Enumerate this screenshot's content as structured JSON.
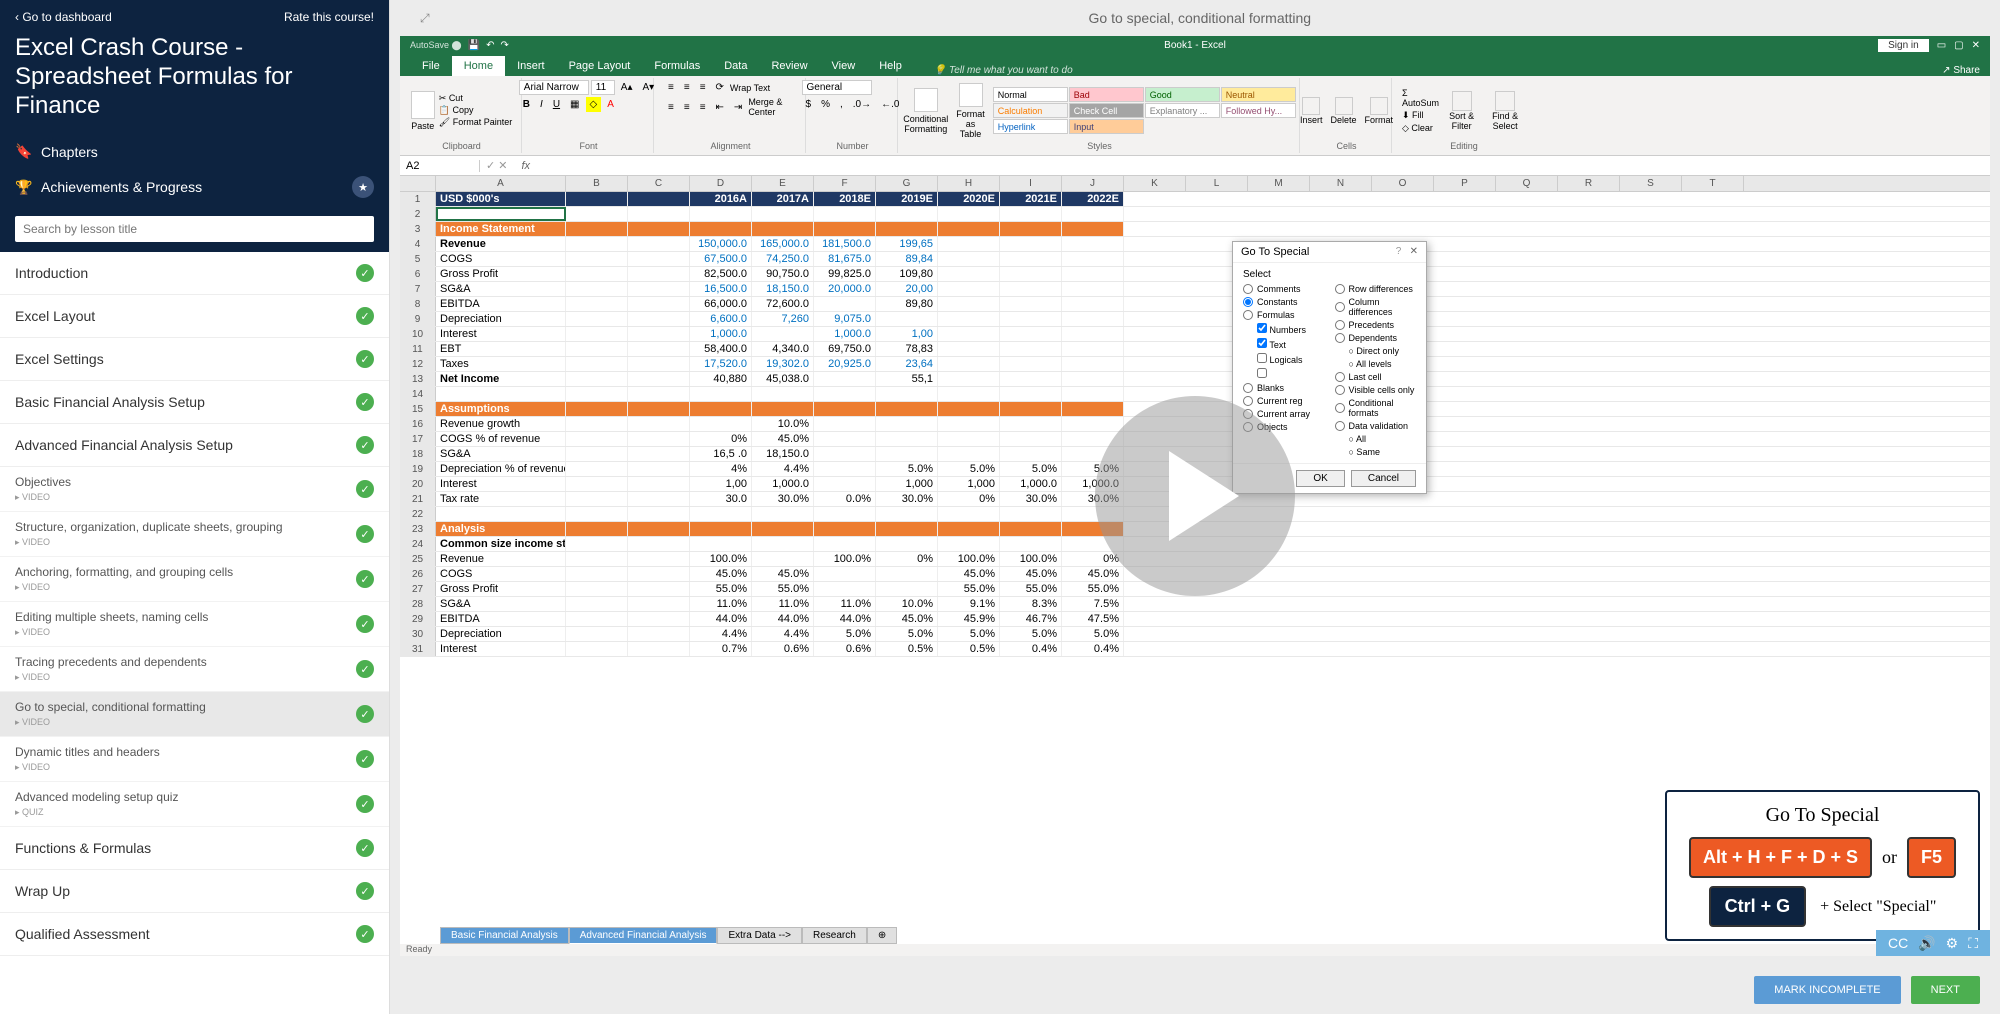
{
  "sidebar": {
    "back_link": "Go to dashboard",
    "rate_link": "Rate this course!",
    "title": "Excel Crash Course - Spreadsheet Formulas for Finance",
    "chapters_label": "Chapters",
    "achievements_label": "Achievements & Progress",
    "search_placeholder": "Search by lesson title",
    "chapters": [
      {
        "title": "Introduction",
        "complete": true
      },
      {
        "title": "Excel Layout",
        "complete": true
      },
      {
        "title": "Excel Settings",
        "complete": true
      },
      {
        "title": "Basic Financial Analysis Setup",
        "complete": true
      },
      {
        "title": "Advanced Financial Analysis Setup",
        "complete": true,
        "expanded": true,
        "subs": [
          {
            "title": "Objectives",
            "type": "VIDEO",
            "complete": true
          },
          {
            "title": "Structure, organization, duplicate sheets, grouping",
            "type": "VIDEO",
            "complete": true
          },
          {
            "title": "Anchoring, formatting, and grouping cells",
            "type": "VIDEO",
            "complete": true
          },
          {
            "title": "Editing multiple sheets, naming cells",
            "type": "VIDEO",
            "complete": true
          },
          {
            "title": "Tracing precedents and dependents",
            "type": "VIDEO",
            "complete": true
          },
          {
            "title": "Go to special, conditional formatting",
            "type": "VIDEO",
            "complete": true,
            "active": true
          },
          {
            "title": "Dynamic titles and headers",
            "type": "VIDEO",
            "complete": true
          },
          {
            "title": "Advanced modeling setup quiz",
            "type": "QUIZ",
            "complete": true
          }
        ]
      },
      {
        "title": "Functions & Formulas",
        "complete": true
      },
      {
        "title": "Wrap Up",
        "complete": true
      },
      {
        "title": "Qualified Assessment",
        "complete": true
      }
    ]
  },
  "main": {
    "lesson_title": "Go to special, conditional formatting",
    "mark_incomplete": "MARK INCOMPLETE",
    "next": "NEXT"
  },
  "excel": {
    "title": "Book1 - Excel",
    "signin": "Sign in",
    "tabs": [
      "File",
      "Home",
      "Insert",
      "Page Layout",
      "Formulas",
      "Data",
      "Review",
      "View",
      "Help"
    ],
    "active_tab": "Home",
    "tellme": "Tell me what you want to do",
    "share": "Share",
    "ribbon": {
      "clipboard": {
        "paste": "Paste",
        "cut": "Cut",
        "copy": "Copy",
        "painter": "Format Painter",
        "label": "Clipboard"
      },
      "font": {
        "name": "Arial Narrow",
        "size": "11",
        "label": "Font"
      },
      "alignment": {
        "wrap": "Wrap Text",
        "merge": "Merge & Center",
        "label": "Alignment"
      },
      "number": {
        "format": "General",
        "label": "Number"
      },
      "styles": {
        "cond": "Conditional Formatting",
        "table": "Format as Table",
        "cells": [
          {
            "t": "Normal",
            "bg": "#fff",
            "c": "#000"
          },
          {
            "t": "Bad",
            "bg": "#ffc7ce",
            "c": "#9c0006"
          },
          {
            "t": "Good",
            "bg": "#c6efce",
            "c": "#006100"
          },
          {
            "t": "Neutral",
            "bg": "#ffeb9c",
            "c": "#9c5700"
          },
          {
            "t": "Calculation",
            "bg": "#f2f2f2",
            "c": "#fa7d00"
          },
          {
            "t": "Check Cell",
            "bg": "#a5a5a5",
            "c": "#fff"
          },
          {
            "t": "Explanatory ...",
            "bg": "#fff",
            "c": "#7f7f7f"
          },
          {
            "t": "Followed Hy...",
            "bg": "#fff",
            "c": "#954f72"
          },
          {
            "t": "Hyperlink",
            "bg": "#fff",
            "c": "#0563c1"
          },
          {
            "t": "Input",
            "bg": "#ffcc99",
            "c": "#3f3f76"
          }
        ],
        "label": "Styles"
      },
      "cells": {
        "insert": "Insert",
        "delete": "Delete",
        "format": "Format",
        "label": "Cells"
      },
      "editing": {
        "autosum": "AutoSum",
        "fill": "Fill",
        "clear": "Clear",
        "sort": "Sort & Filter",
        "find": "Find & Select",
        "label": "Editing"
      }
    },
    "namebox": "A2",
    "columns": [
      "A",
      "B",
      "C",
      "D",
      "E",
      "F",
      "G",
      "H",
      "I",
      "J",
      "K",
      "L",
      "M",
      "N",
      "O",
      "P",
      "Q",
      "R",
      "S",
      "T"
    ],
    "sheet_tabs": [
      "Basic Financial Analysis",
      "Advanced Financial Analysis",
      "Extra Data -->",
      "Research"
    ],
    "status": "Ready",
    "grid": [
      {
        "r": 1,
        "type": "header",
        "a": "USD $000's",
        "vals": [
          "",
          "",
          "2016A",
          "2017A",
          "2018E",
          "2019E",
          "2020E",
          "2021E",
          "2022E"
        ]
      },
      {
        "r": 2,
        "type": "sel",
        "a": "",
        "vals": [
          "",
          "",
          "",
          "",
          "",
          "",
          "",
          "",
          ""
        ]
      },
      {
        "r": 3,
        "type": "section",
        "a": "Income Statement",
        "vals": [
          "",
          "",
          "",
          "",
          "",
          "",
          "",
          "",
          ""
        ]
      },
      {
        "r": 4,
        "type": "bold",
        "a": "Revenue",
        "cls": "blue-text",
        "vals": [
          "",
          "",
          "150,000.0",
          "165,000.0",
          "181,500.0",
          "199,65",
          "",
          "",
          ""
        ]
      },
      {
        "r": 5,
        "a": "COGS",
        "cls": "blue-text",
        "vals": [
          "",
          "",
          "67,500.0",
          "74,250.0",
          "81,675.0",
          "89,84",
          "",
          "",
          ""
        ]
      },
      {
        "r": 6,
        "a": "Gross Profit",
        "vals": [
          "",
          "",
          "82,500.0",
          "90,750.0",
          "99,825.0",
          "109,80",
          "",
          "",
          ""
        ]
      },
      {
        "r": 7,
        "a": "SG&A",
        "cls": "blue-text",
        "vals": [
          "",
          "",
          "16,500.0",
          "18,150.0",
          "20,000.0",
          "20,00",
          "",
          "",
          ""
        ]
      },
      {
        "r": 8,
        "a": "EBITDA",
        "vals": [
          "",
          "",
          "66,000.0",
          "72,600.0",
          "",
          "89,80",
          "",
          "",
          ""
        ]
      },
      {
        "r": 9,
        "a": "Depreciation",
        "cls": "blue-text",
        "vals": [
          "",
          "",
          "6,600.0",
          "7,260",
          "9,075.0",
          "",
          "",
          "",
          ""
        ]
      },
      {
        "r": 10,
        "a": "Interest",
        "cls": "blue-text",
        "vals": [
          "",
          "",
          "1,000.0",
          "",
          "1,000.0",
          "1,00",
          "",
          "",
          ""
        ]
      },
      {
        "r": 11,
        "a": "EBT",
        "vals": [
          "",
          "",
          "58,400.0",
          "4,340.0",
          "69,750.0",
          "78,83",
          "",
          "",
          ""
        ]
      },
      {
        "r": 12,
        "a": "Taxes",
        "cls": "blue-text",
        "vals": [
          "",
          "",
          "17,520.0",
          "19,302.0",
          "20,925.0",
          "23,64",
          "",
          "",
          ""
        ]
      },
      {
        "r": 13,
        "type": "bold",
        "a": "Net Income",
        "vals": [
          "",
          "",
          "40,880",
          "45,038.0",
          "",
          "55,1",
          "",
          "",
          ""
        ]
      },
      {
        "r": 14,
        "a": "",
        "vals": [
          "",
          "",
          "",
          "",
          "",
          "",
          "",
          "",
          ""
        ]
      },
      {
        "r": 15,
        "type": "section",
        "a": "Assumptions",
        "vals": [
          "",
          "",
          "",
          "",
          "",
          "",
          "",
          "",
          ""
        ]
      },
      {
        "r": 16,
        "a": "Revenue growth",
        "vals": [
          "",
          "",
          "",
          "10.0%",
          "",
          "",
          "",
          "",
          ""
        ]
      },
      {
        "r": 17,
        "a": "COGS % of revenue",
        "vals": [
          "",
          "",
          "0%",
          "45.0%",
          "",
          "",
          "",
          "",
          ""
        ]
      },
      {
        "r": 18,
        "a": "SG&A",
        "vals": [
          "",
          "",
          "16,5   .0",
          "18,150.0",
          "",
          "",
          "",
          "",
          ""
        ]
      },
      {
        "r": 19,
        "a": "Depreciation % of revenue",
        "vals": [
          "",
          "",
          "4%",
          "4.4%",
          "",
          "5.0%",
          "5.0%",
          "5.0%",
          "5.0%"
        ]
      },
      {
        "r": 20,
        "a": "Interest",
        "vals": [
          "",
          "",
          "1,00",
          "1,000.0",
          "",
          "1,000",
          "1,000",
          "1,000.0",
          "1,000.0"
        ]
      },
      {
        "r": 21,
        "a": "Tax rate",
        "vals": [
          "",
          "",
          "30.0",
          "30.0%",
          "0.0%",
          "30.0%",
          "0%",
          "30.0%",
          "30.0%"
        ]
      },
      {
        "r": 22,
        "a": "",
        "vals": [
          "",
          "",
          "",
          "",
          "",
          "",
          "",
          "",
          ""
        ]
      },
      {
        "r": 23,
        "type": "section",
        "a": "Analysis",
        "vals": [
          "",
          "",
          "",
          "",
          "",
          "",
          "",
          "",
          ""
        ]
      },
      {
        "r": 24,
        "type": "bold",
        "a": "Common size income statement",
        "vals": [
          "",
          "",
          "",
          "",
          "",
          "",
          "",
          "",
          ""
        ]
      },
      {
        "r": 25,
        "a": "Revenue",
        "vals": [
          "",
          "",
          "100.0%",
          "",
          "100.0%",
          "0%",
          "100.0%",
          "100.0%",
          "0%"
        ]
      },
      {
        "r": 26,
        "a": "COGS",
        "vals": [
          "",
          "",
          "45.0%",
          "45.0%",
          "",
          "",
          "45.0%",
          "45.0%",
          "45.0%"
        ]
      },
      {
        "r": 27,
        "a": "Gross Profit",
        "vals": [
          "",
          "",
          "55.0%",
          "55.0%",
          "",
          "",
          "55.0%",
          "55.0%",
          "55.0%"
        ]
      },
      {
        "r": 28,
        "a": "SG&A",
        "vals": [
          "",
          "",
          "11.0%",
          "11.0%",
          "11.0%",
          "10.0%",
          "9.1%",
          "8.3%",
          "7.5%"
        ]
      },
      {
        "r": 29,
        "a": "EBITDA",
        "vals": [
          "",
          "",
          "44.0%",
          "44.0%",
          "44.0%",
          "45.0%",
          "45.9%",
          "46.7%",
          "47.5%"
        ]
      },
      {
        "r": 30,
        "a": "Depreciation",
        "vals": [
          "",
          "",
          "4.4%",
          "4.4%",
          "5.0%",
          "5.0%",
          "5.0%",
          "5.0%",
          "5.0%"
        ]
      },
      {
        "r": 31,
        "a": "Interest",
        "vals": [
          "",
          "",
          "0.7%",
          "0.6%",
          "0.6%",
          "0.5%",
          "0.5%",
          "0.4%",
          "0.4%"
        ]
      }
    ],
    "dialog": {
      "title": "Go To Special",
      "select": "Select",
      "left": [
        "Comments",
        "Constants",
        "Formulas",
        "Numbers",
        "Text",
        "Logicals",
        "",
        "Blanks",
        "Current reg",
        "Current array",
        "Objects"
      ],
      "right": [
        "Row differences",
        "Column differences",
        "Precedents",
        "Dependents",
        "Direct only",
        "All levels",
        "Last cell",
        "Visible cells only",
        "Conditional formats",
        "Data validation",
        "All",
        "Same"
      ],
      "ok": "OK",
      "cancel": "Cancel"
    }
  },
  "shortcut": {
    "title": "Go To Special",
    "combo1": "Alt + H + F + D + S",
    "or": "or",
    "combo2": "F5",
    "combo3": "Ctrl + G",
    "suffix": "+ Select \"Special\""
  }
}
